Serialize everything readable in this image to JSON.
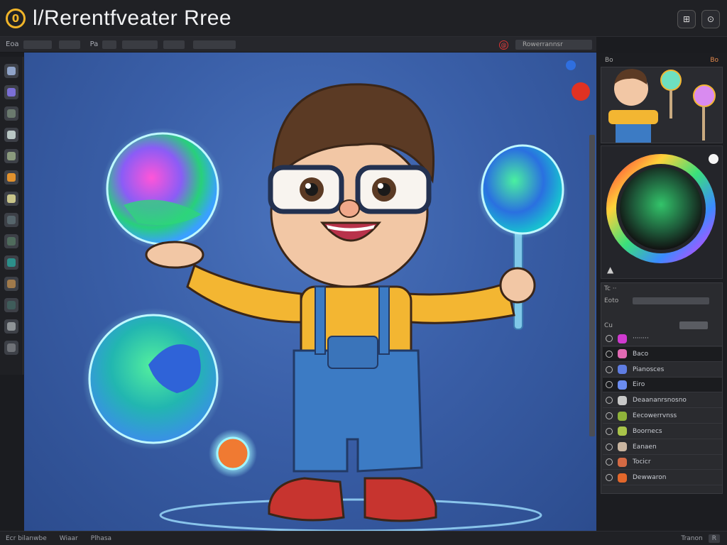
{
  "app": {
    "logo_glyph": "0",
    "title": "l/Rerentfveater Rree"
  },
  "window": {
    "btn1_glyph": "⊞",
    "btn2_glyph": "⊙"
  },
  "toolbar": {
    "items": [
      "Eoa",
      "···",
      "Pa",
      "····",
      "····"
    ],
    "record_glyph": "@",
    "search_text": "Rowerrannsr"
  },
  "tools": [
    {
      "name": "select",
      "color": "#8fa3c8"
    },
    {
      "name": "shape",
      "color": "#7b6fd6"
    },
    {
      "name": "pen",
      "color": "#6b7a6e"
    },
    {
      "name": "eraser",
      "color": "#b9c7c4"
    },
    {
      "name": "fill",
      "color": "#8a9a7d"
    },
    {
      "name": "color-pick",
      "color": "#e0912e"
    },
    {
      "name": "smudge",
      "color": "#c9c58a"
    },
    {
      "name": "brush",
      "color": "#56656b"
    },
    {
      "name": "stamp",
      "color": "#4f6b5c"
    },
    {
      "name": "drop",
      "color": "#2c8f8a"
    },
    {
      "name": "blur",
      "color": "#a07a4b"
    },
    {
      "name": "texture",
      "color": "#3f5c5a"
    },
    {
      "name": "light",
      "color": "#8e9396"
    },
    {
      "name": "guide",
      "color": "#6f7277"
    }
  ],
  "preview": {
    "label": "Bo",
    "badge": "Bo"
  },
  "colors": {
    "bg": "#3a5fa8",
    "skin": "#f2c7a5",
    "hair": "#5b3a24",
    "shirt": "#f3b632",
    "overall": "#3c7bc4",
    "shoe": "#c7342f",
    "red_swatch": "#e03222",
    "blue_swatch": "#2f6fe0"
  },
  "layers_panel": {
    "header": "Tc ··",
    "row_label": "Eoto",
    "filter_label": "Cu",
    "items": [
      {
        "label": "········",
        "swatch": "#d03ad0",
        "selected": false
      },
      {
        "label": "Baco",
        "swatch": "#e26ab4",
        "selected": true
      },
      {
        "label": "Pianosces",
        "swatch": "#5f7de2",
        "selected": false
      },
      {
        "label": "Eiro",
        "swatch": "#6b8cf0",
        "selected": true
      },
      {
        "label": "Deaananrsnosno",
        "swatch": "#c8c8c8",
        "selected": false
      },
      {
        "label": "Eecowerrvnss",
        "swatch": "#8fb33a",
        "selected": false
      },
      {
        "label": "Boornecs",
        "swatch": "#a9c44a",
        "selected": false
      },
      {
        "label": "Eanaen",
        "swatch": "#c9b5a0",
        "selected": false
      },
      {
        "label": "Tocicr",
        "swatch": "#d46a44",
        "selected": false
      },
      {
        "label": "Dewwaron",
        "swatch": "#e2672b",
        "selected": false
      }
    ]
  },
  "status": {
    "items": [
      "Ecr bilanwbe",
      "Wiaar",
      "Plhasa"
    ],
    "right_items": [
      "Tranon",
      "R"
    ]
  }
}
